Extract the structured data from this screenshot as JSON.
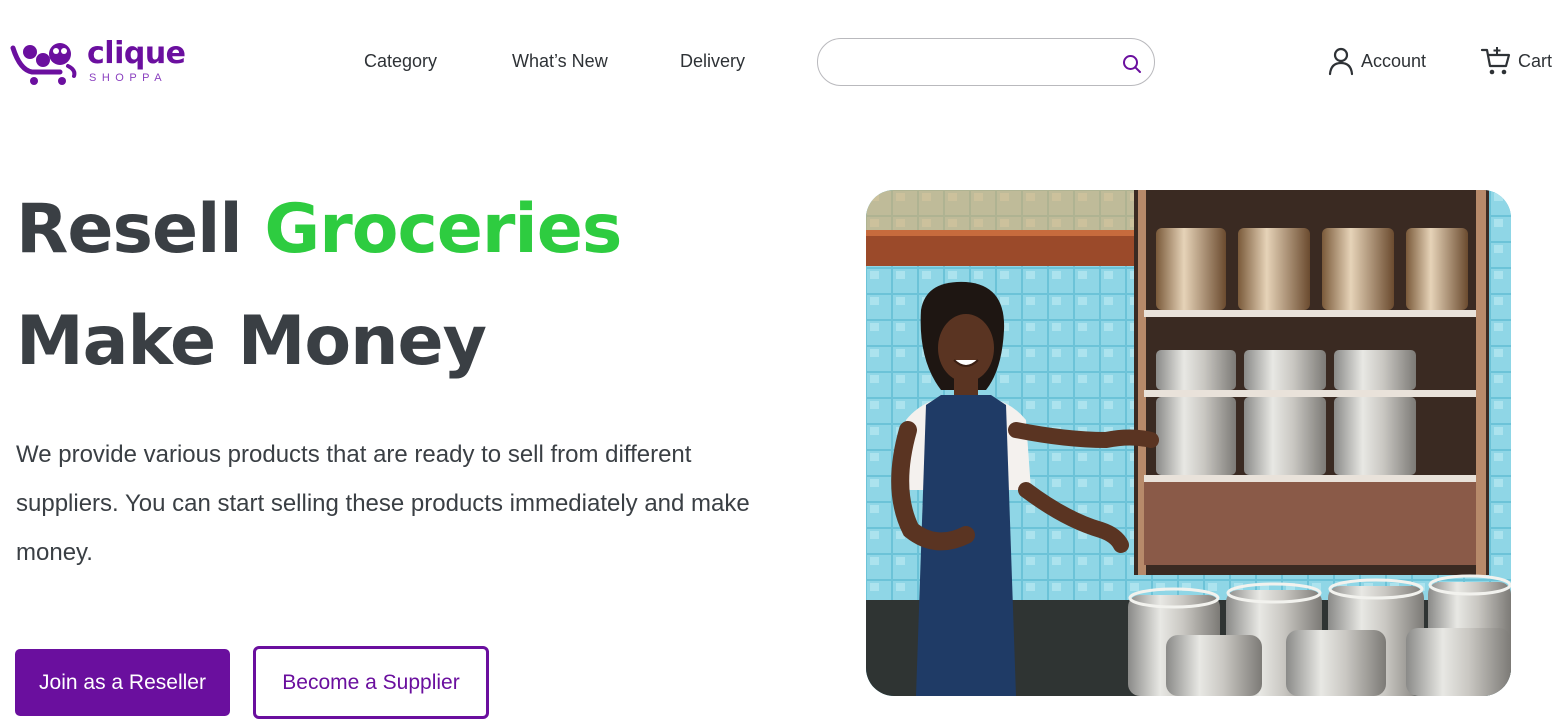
{
  "brand": {
    "name": "clique",
    "tagline": "SHOPPA",
    "color": "#6b0f9f"
  },
  "nav": {
    "items": [
      {
        "label": "Category"
      },
      {
        "label": "What’s New"
      },
      {
        "label": "Delivery"
      }
    ]
  },
  "search": {
    "value": "",
    "placeholder": "",
    "icon": "search-icon"
  },
  "header_actions": {
    "account_label": "Account",
    "cart_label": "Cart"
  },
  "hero": {
    "headline_part1": "Resell",
    "headline_accent": "Groceries",
    "headline_line2": "Make Money",
    "description": "We provide various products that are ready to sell from different suppliers. You can start selling these products immediately and make money.",
    "primary_button": "Join as a Reseller",
    "secondary_button": "Become a Supplier",
    "image_alt": "Smiling woman in an apron presenting shelves of steel kegs"
  },
  "colors": {
    "accent_green": "#2ecc40",
    "primary_purple": "#6a0f9e",
    "text_dark": "#3a3f44"
  }
}
